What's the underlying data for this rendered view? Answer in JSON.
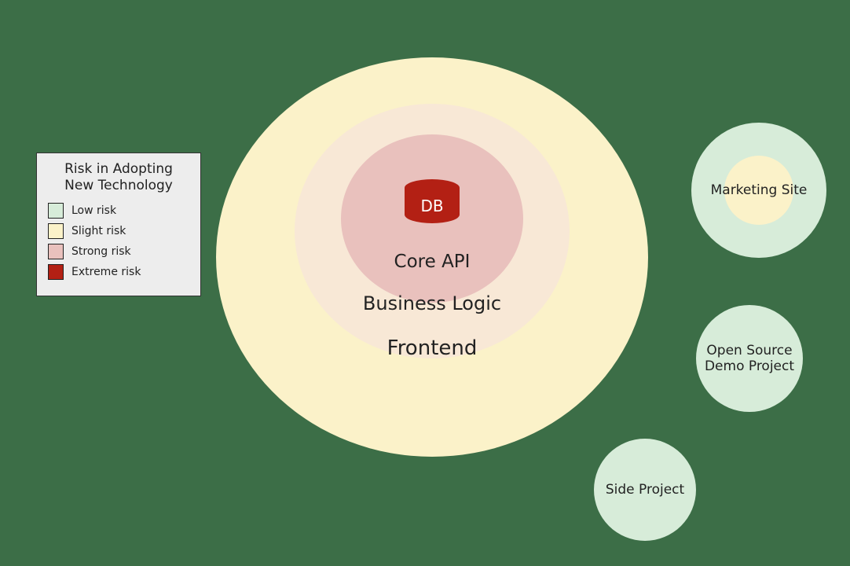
{
  "colors": {
    "low": "#d7ecd9",
    "slight": "#fbf2c9",
    "strong": "#e9c1bd",
    "extreme": "#b32014",
    "bizRing": "#f8e8d6"
  },
  "legend": {
    "title": "Risk in Adopting New Technology",
    "items": [
      {
        "label": "Low risk",
        "colorKey": "low"
      },
      {
        "label": "Slight risk",
        "colorKey": "slight"
      },
      {
        "label": "Strong risk",
        "colorKey": "strong"
      },
      {
        "label": "Extreme risk",
        "colorKey": "extreme"
      }
    ]
  },
  "mainStack": {
    "layers": [
      {
        "name": "Frontend",
        "riskKey": "slight"
      },
      {
        "name": "Business Logic",
        "riskKey": "bizRing"
      },
      {
        "name": "Core API",
        "riskKey": "strong"
      },
      {
        "name": "DB",
        "riskKey": "extreme"
      }
    ]
  },
  "satellites": {
    "marketing": {
      "label": "Marketing Site",
      "outerRiskKey": "low",
      "innerRiskKey": "slight"
    },
    "openSource": {
      "label": "Open Source\nDemo Project",
      "riskKey": "low"
    },
    "sideProject": {
      "label": "Side Project",
      "riskKey": "low"
    }
  }
}
